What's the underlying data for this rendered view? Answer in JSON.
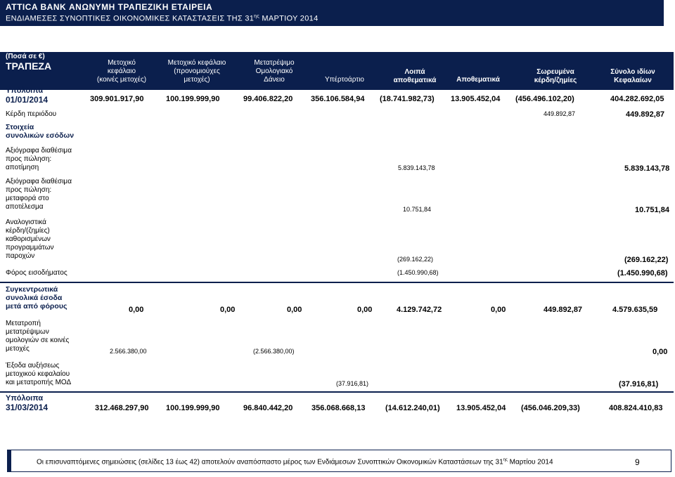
{
  "header": {
    "company": "ATTICA BANK ΑΝΩΝΥΜΗ ΤΡΑΠΕΖΙΚΗ ΕΤΑΙΡΕΙΑ",
    "subtitle_main": "ΕΝΔΙΑΜΕΣΕΣ ΣΥΝΟΠΤΙΚΕΣ ΟΙΚΟΝΟΜΙΚΕΣ ΚΑΤΑΣΤΑΣΕΙΣ ΤΗΣ 31",
    "subtitle_sup": "ης",
    "subtitle_end": " ΜΑΡΤΙΟΥ 2014"
  },
  "table": {
    "currency_note": "(Ποσά σε €)",
    "entity": "ΤΡΑΠΕΖΑ",
    "columns": [
      {
        "l1": "Μετοχικό",
        "l2": "κεφάλαιο",
        "l3": "(κοινές μετοχές)"
      },
      {
        "l1": "Μετοχικό κεφάλαιο",
        "l2": "(προνομιούχες",
        "l3": "μετοχές)"
      },
      {
        "l1": "Μετατρέψιμο",
        "l2": "Ομολογιακό",
        "l3": "Δάνειο"
      },
      {
        "l1": "Υπέρτοάρτιο"
      },
      {
        "l1": "Λοιπά",
        "l2": "αποθεματικά"
      },
      {
        "l1": "Αποθεματικά"
      },
      {
        "l1": "Σωρευμένα",
        "l2": "κέρδη/ζημίες"
      },
      {
        "l1": "Σύνολο ιδίων",
        "l2": "Κεφαλαίων"
      }
    ],
    "opening": {
      "label1": "Υπόλοιπα",
      "label2": "01/01/2014",
      "values": [
        "309.901.917,90",
        "100.199.999,90",
        "99.406.822,20",
        "356.106.584,94",
        "(18.741.982,73)",
        "13.905.452,04",
        "(456.496.102,20)",
        "404.282.692,05"
      ]
    },
    "profit": {
      "label": "Κέρδη περιόδου",
      "accumulated": "449.892,87",
      "total": "449.892,87"
    },
    "oci_heading": {
      "l1": "Στοιχεία",
      "l2": "συνολικών εσόδων"
    },
    "afs_valuation": {
      "l1": "Αξιόγραφα διαθέσιμα",
      "l2": "προς πώληση:",
      "l3": "αποτίμηση",
      "other": "5.839.143,78",
      "total": "5.839.143,78"
    },
    "afs_transfer": {
      "l1": "Αξιόγραφα διαθέσιμα",
      "l2": "προς πώληση:",
      "l3": "μεταφορά στο",
      "l4": "αποτέλεσμα",
      "other": "10.751,84",
      "total": "10.751,84"
    },
    "actuarial": {
      "l1": "Αναλογιστικά",
      "l2": "κέρδη/(ζημίες)",
      "l3": "καθορισμένων",
      "l4": "προγραμμάτων",
      "l5": "παροχών",
      "other": "(269.162,22)",
      "total": "(269.162,22)"
    },
    "tax": {
      "label": "Φόρος εισοδήματος",
      "other": "(1.450.990,68)",
      "total": "(1.450.990,68)"
    },
    "comprehensive": {
      "l1": "Συγκεντρωτικά",
      "l2": "συνολικά έσοδα",
      "l3": "μετά από φόρους",
      "values": [
        "0,00",
        "0,00",
        "0,00",
        "0,00",
        "4.129.742,72",
        "0,00",
        "449.892,87",
        "4.579.635,59"
      ]
    },
    "conversion": {
      "l1": "Μετατροπή",
      "l2": "μετατρέψιμων",
      "l3": "ομολογιών σε κοινές",
      "l4": "μετοχές",
      "common": "2.566.380,00",
      "bond": "(2.566.380,00)",
      "total": "0,00"
    },
    "expenses": {
      "l1": "Έξοδα αυξήσεως",
      "l2": "μετοχικού κεφαλαίου",
      "l3": "και μετατροπής ΜΟΔ",
      "premium": "(37.916,81)",
      "total": "(37.916,81)"
    },
    "closing": {
      "label1": "Υπόλοιπα",
      "label2": "31/03/2014",
      "values": [
        "312.468.297,90",
        "100.199.999,90",
        "96.840.442,20",
        "356.068.668,13",
        "(14.612.240,01)",
        "13.905.452,04",
        "(456.046.209,33)",
        "408.824.410,83"
      ]
    }
  },
  "footer": {
    "note_a": "Οι επισυναπτόμενες σημειώσεις (σελίδες 13 έως 42) αποτελούν αναπόσπαστο μέρος των Ενδιάμεσων Συνοπτικών Οικονομικών Καταστάσεων της 31",
    "note_sup": "ης",
    "note_b": " Μαρτίου 2014",
    "page": "9"
  },
  "colors": {
    "navy": "#0b1f4d"
  }
}
